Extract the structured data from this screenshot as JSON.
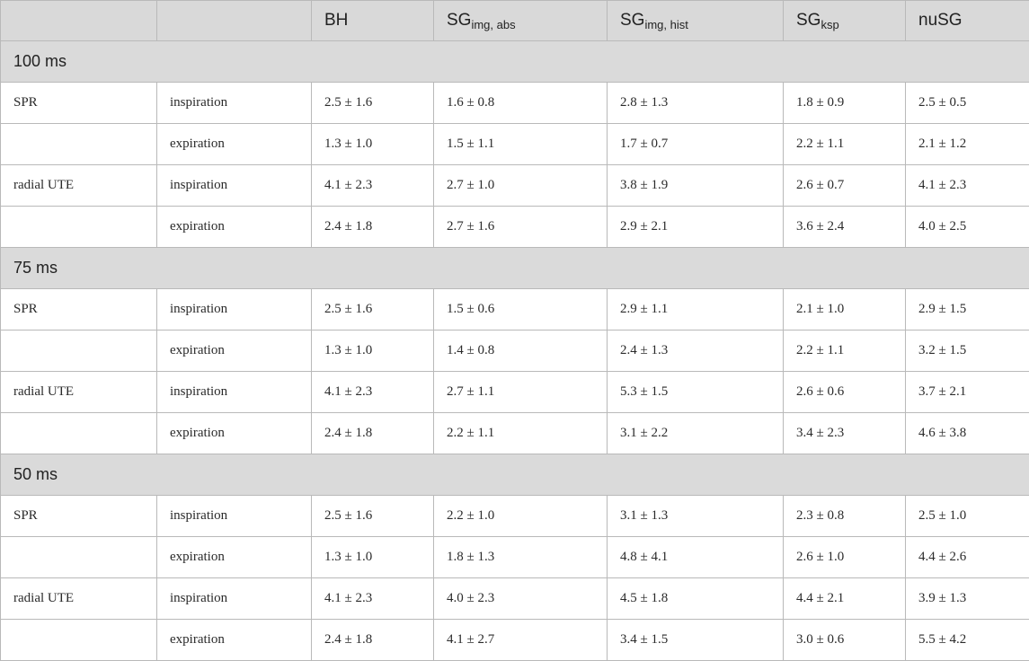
{
  "header": {
    "col0": "",
    "col1": "",
    "bh": "BH",
    "sg_img_abs": {
      "base": "SG",
      "sub": "img, abs"
    },
    "sg_img_hist": {
      "base": "SG",
      "sub": "img, hist"
    },
    "sg_ksp": {
      "base": "SG",
      "sub": "ksp"
    },
    "nusg": "nuSG"
  },
  "sections": [
    {
      "title": "100 ms",
      "rows": [
        {
          "seq": "SPR",
          "phase": "inspiration",
          "values": [
            "2.5 ± 1.6",
            "1.6 ± 0.8",
            "2.8 ± 1.3",
            "1.8 ± 0.9",
            "2.5 ± 0.5"
          ]
        },
        {
          "seq": "",
          "phase": "expiration",
          "values": [
            "1.3 ± 1.0",
            "1.5 ± 1.1",
            "1.7 ± 0.7",
            "2.2 ± 1.1",
            "2.1 ± 1.2"
          ]
        },
        {
          "seq": "radial UTE",
          "phase": "inspiration",
          "values": [
            "4.1 ± 2.3",
            "2.7 ± 1.0",
            "3.8 ± 1.9",
            "2.6 ± 0.7",
            "4.1 ± 2.3"
          ]
        },
        {
          "seq": "",
          "phase": "expiration",
          "values": [
            "2.4 ± 1.8",
            "2.7 ± 1.6",
            "2.9 ± 2.1",
            "3.6 ± 2.4",
            "4.0 ± 2.5"
          ]
        }
      ]
    },
    {
      "title": "75 ms",
      "rows": [
        {
          "seq": "SPR",
          "phase": "inspiration",
          "values": [
            "2.5 ± 1.6",
            "1.5 ± 0.6",
            "2.9 ± 1.1",
            "2.1 ± 1.0",
            "2.9 ± 1.5"
          ]
        },
        {
          "seq": "",
          "phase": "expiration",
          "values": [
            "1.3 ± 1.0",
            "1.4 ± 0.8",
            "2.4 ± 1.3",
            "2.2 ± 1.1",
            "3.2 ± 1.5"
          ]
        },
        {
          "seq": "radial UTE",
          "phase": "inspiration",
          "values": [
            "4.1 ± 2.3",
            "2.7 ± 1.1",
            "5.3 ± 1.5",
            "2.6 ± 0.6",
            "3.7 ± 2.1"
          ]
        },
        {
          "seq": "",
          "phase": "expiration",
          "values": [
            "2.4 ± 1.8",
            "2.2 ± 1.1",
            "3.1 ± 2.2",
            "3.4 ± 2.3",
            "4.6 ± 3.8"
          ]
        }
      ]
    },
    {
      "title": "50 ms",
      "rows": [
        {
          "seq": "SPR",
          "phase": "inspiration",
          "values": [
            "2.5 ± 1.6",
            "2.2 ± 1.0",
            "3.1 ± 1.3",
            "2.3 ± 0.8",
            "2.5 ± 1.0"
          ]
        },
        {
          "seq": "",
          "phase": "expiration",
          "values": [
            "1.3 ± 1.0",
            "1.8 ± 1.3",
            "4.8 ± 4.1",
            "2.6 ± 1.0",
            "4.4 ± 2.6"
          ]
        },
        {
          "seq": "radial UTE",
          "phase": "inspiration",
          "values": [
            "4.1 ± 2.3",
            "4.0 ± 2.3",
            "4.5 ± 1.8",
            "4.4 ± 2.1",
            "3.9 ± 1.3"
          ]
        },
        {
          "seq": "",
          "phase": "expiration",
          "values": [
            "2.4 ± 1.8",
            "4.1 ± 2.7",
            "3.4 ± 1.5",
            "3.0 ± 0.6",
            "5.5 ± 4.2"
          ]
        }
      ]
    }
  ]
}
